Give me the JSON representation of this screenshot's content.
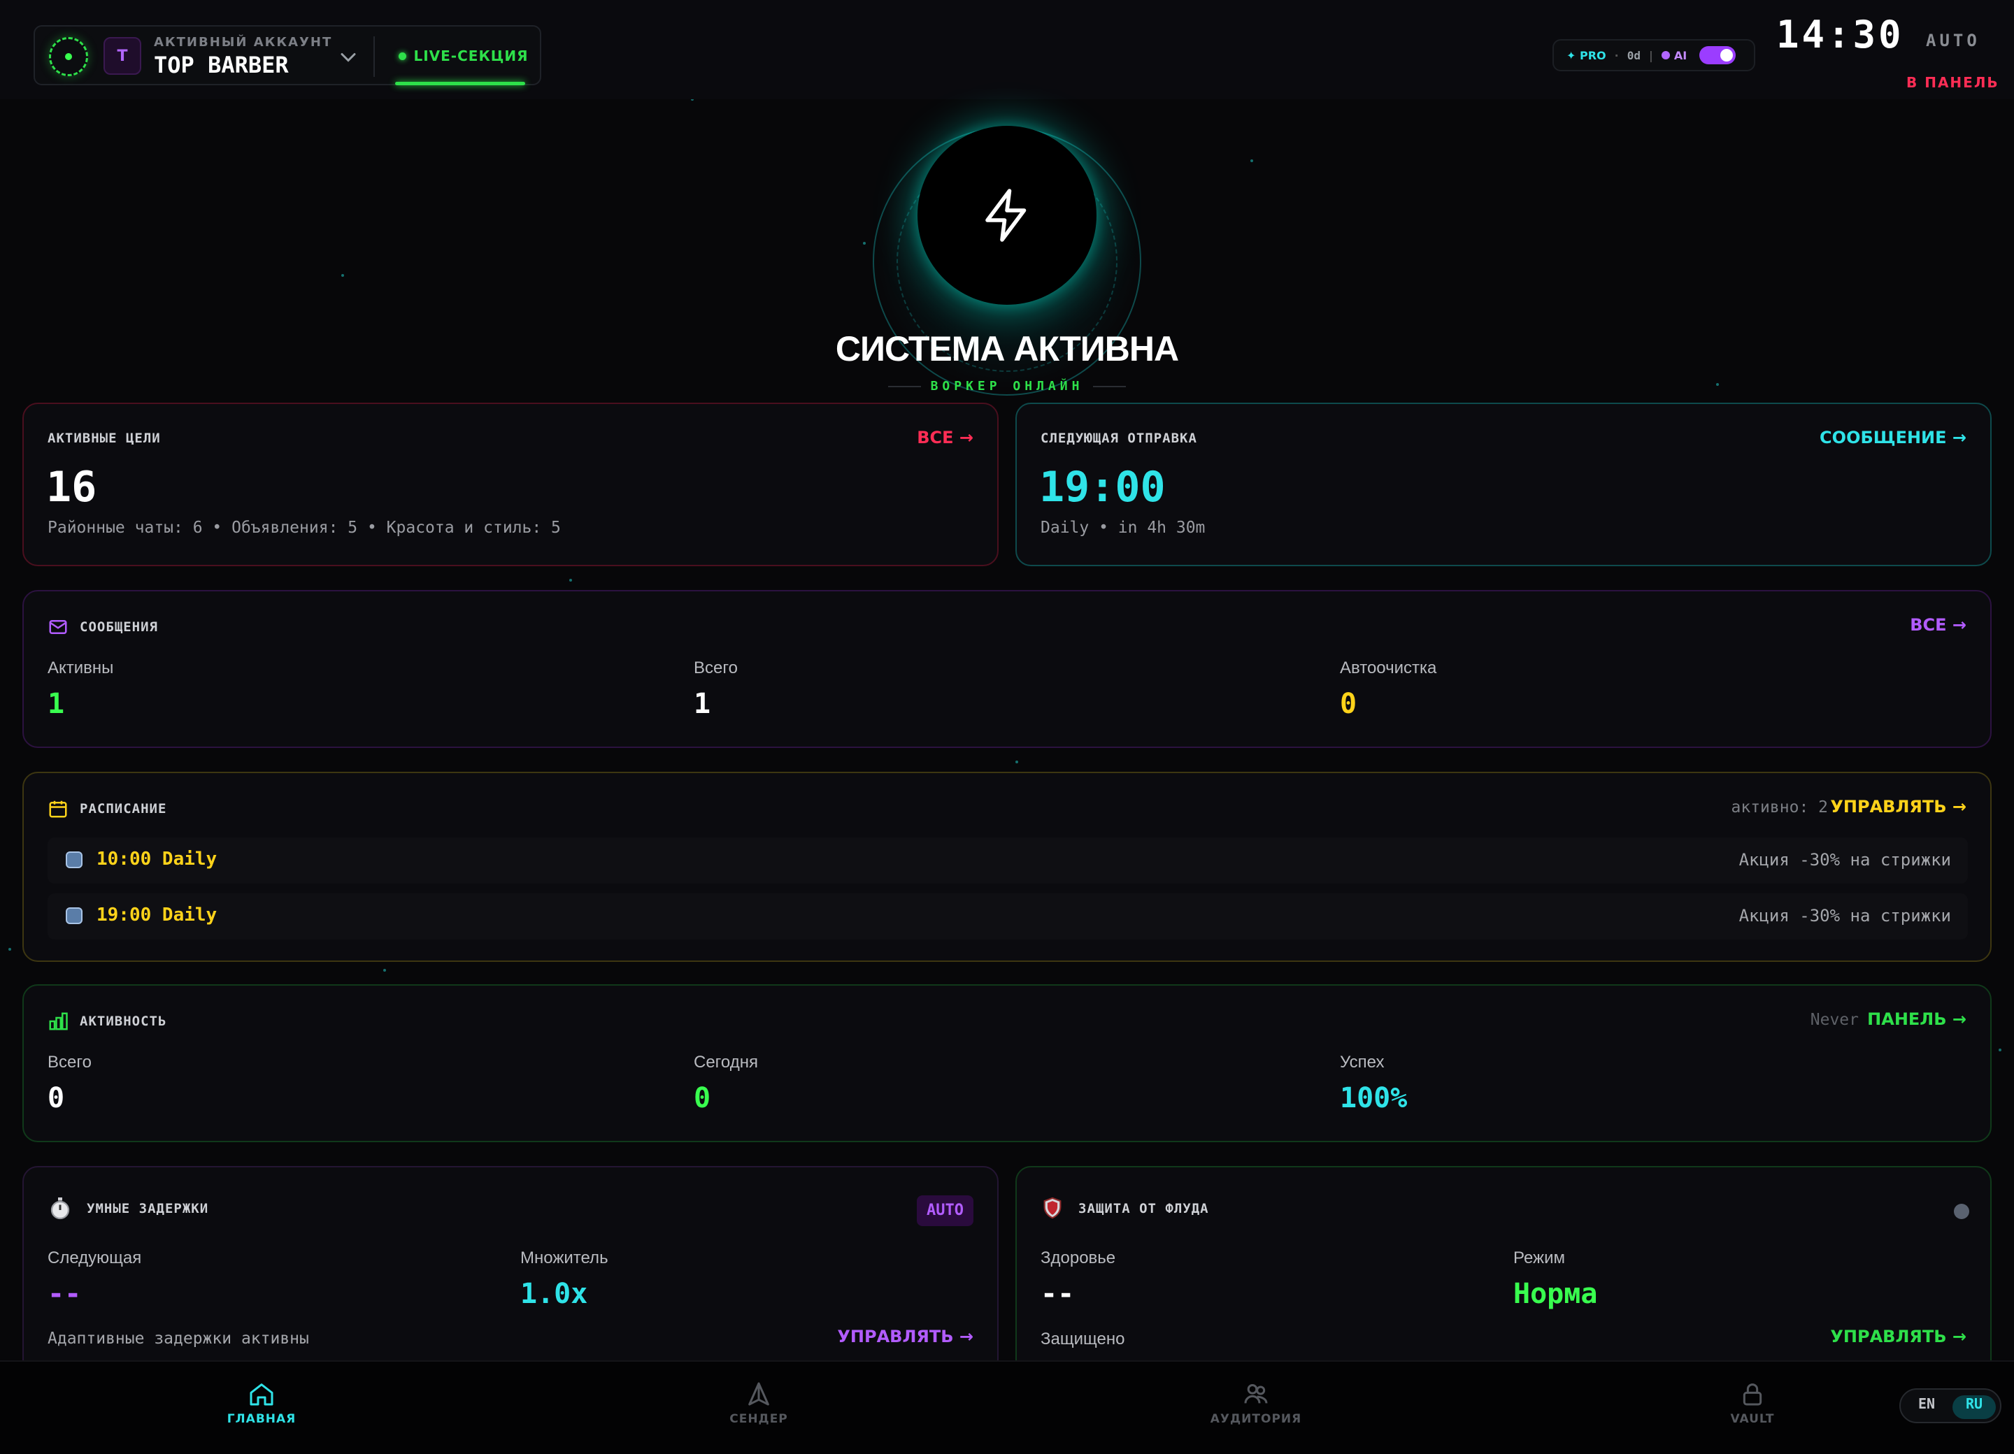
{
  "header": {
    "account_kicker": "АКТИВНЫЙ АККАУНТ",
    "account_name": "TOP BARBER",
    "account_initial": "T",
    "live_tab": "LIVE-СЕКЦИЯ",
    "plan": "PRO",
    "plan_days": "0d",
    "ai_label": "AI",
    "ai_enabled": true,
    "clock": "14:30",
    "mode": "AUTO",
    "panel_link": "В ПАНЕЛЬ"
  },
  "hero": {
    "icon": "lightning-icon",
    "title": "СИСТЕМА АКТИВНА",
    "subtitle": "ВОРКЕР ОНЛАЙН"
  },
  "targets": {
    "title": "АКТИВНЫЕ ЦЕЛИ",
    "link": "ВСЕ →",
    "value": "16",
    "breakdown": "Районные чаты: 6 • Объявления: 5 • Красота и стиль: 5"
  },
  "next_send": {
    "title": "СЛЕДУЮЩАЯ ОТПРАВКА",
    "link": "СООБЩЕНИЕ →",
    "value": "19:00",
    "detail": "Daily • in 4h 30m"
  },
  "messages": {
    "title": "СООБЩЕНИЯ",
    "link": "ВСЕ →",
    "stats": [
      {
        "label": "Активны",
        "value": "1"
      },
      {
        "label": "Всего",
        "value": "1"
      },
      {
        "label": "Автоочистка",
        "value": "0"
      }
    ]
  },
  "schedule": {
    "title": "РАСПИСАНИЕ",
    "active_count": "активно: 2",
    "link": "УПРАВЛЯТЬ →",
    "rows": [
      {
        "time": "10:00 Daily",
        "message": "Акция -30% на стрижки"
      },
      {
        "time": "19:00 Daily",
        "message": "Акция -30% на стрижки"
      }
    ]
  },
  "activity": {
    "title": "АКТИВНОСТЬ",
    "last": "Never",
    "link": "ПАНЕЛЬ →",
    "stats": [
      {
        "label": "Всего",
        "value": "0"
      },
      {
        "label": "Сегодня",
        "value": "0"
      },
      {
        "label": "Успех",
        "value": "100%"
      }
    ]
  },
  "delays": {
    "title": "УМНЫЕ ЗАДЕРЖКИ",
    "badge": "AUTO",
    "stats": [
      {
        "label": "Следующая",
        "value": "--"
      },
      {
        "label": "Множитель",
        "value": "1.0x"
      }
    ],
    "footer": "Адаптивные задержки активны",
    "link": "УПРАВЛЯТЬ →"
  },
  "flood": {
    "title": "ЗАЩИТА ОТ ФЛУДА",
    "stats": [
      {
        "label": "Здоровье",
        "value": "--"
      },
      {
        "label": "Режим",
        "value": "Норма"
      }
    ],
    "footer": "Защищено",
    "link": "УПРАВЛЯТЬ →"
  },
  "nav": {
    "items": [
      {
        "label": "ГЛАВНАЯ",
        "icon": "home-icon",
        "active": true
      },
      {
        "label": "СЕНДЕР",
        "icon": "send-icon",
        "active": false
      },
      {
        "label": "АУДИТОРИЯ",
        "icon": "users-icon",
        "active": false
      },
      {
        "label": "VAULT",
        "icon": "lock-icon",
        "active": false
      }
    ],
    "lang_en": "EN",
    "lang_ru": "RU",
    "lang_selected": "RU"
  },
  "colors": {
    "background": "#070709",
    "green": "#2ee04a",
    "cyan": "#2fe3e8",
    "red": "#ff2d55",
    "yellow": "#ffd31a",
    "purple": "#b25cff"
  }
}
